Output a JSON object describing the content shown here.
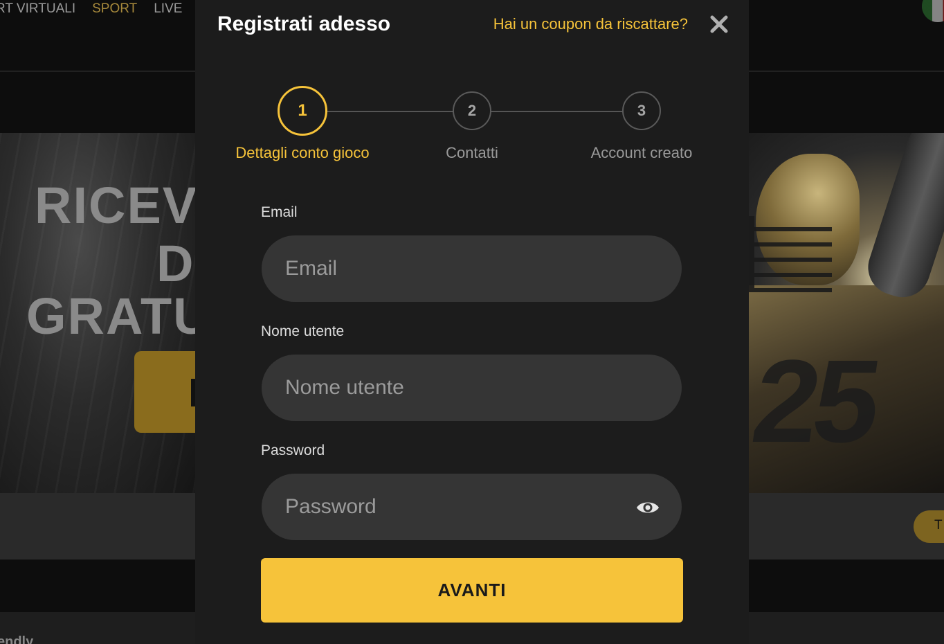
{
  "nav": {
    "items": [
      {
        "label": "RT VIRTUALI",
        "active": false
      },
      {
        "label": "SPORT",
        "active": true
      },
      {
        "label": "LIVE",
        "active": false
      }
    ]
  },
  "background": {
    "banner_left_lines": [
      "RICEV",
      "D",
      "GRATU"
    ],
    "side_button_label": "T",
    "footer_partial_text": "endly"
  },
  "modal": {
    "title": "Registrati adesso",
    "coupon_link": "Hai un coupon da riscattare?",
    "close_icon": "close-icon",
    "steps": [
      {
        "number": "1",
        "label": "Dettagli conto gioco",
        "state": "active"
      },
      {
        "number": "2",
        "label": "Contatti",
        "state": "idle"
      },
      {
        "number": "3",
        "label": "Account creato",
        "state": "idle"
      }
    ],
    "fields": {
      "email": {
        "label": "Email",
        "placeholder": "Email",
        "value": ""
      },
      "username": {
        "label": "Nome utente",
        "placeholder": "Nome utente",
        "value": ""
      },
      "password": {
        "label": "Password",
        "placeholder": "Password",
        "value": "",
        "toggle_icon": "eye-icon"
      }
    },
    "submit_label": "AVANTI"
  },
  "colors": {
    "accent": "#f6c33a",
    "modal_bg": "#1c1c1c",
    "field_bg": "#353535",
    "page_bg": "#0d0d0d"
  }
}
